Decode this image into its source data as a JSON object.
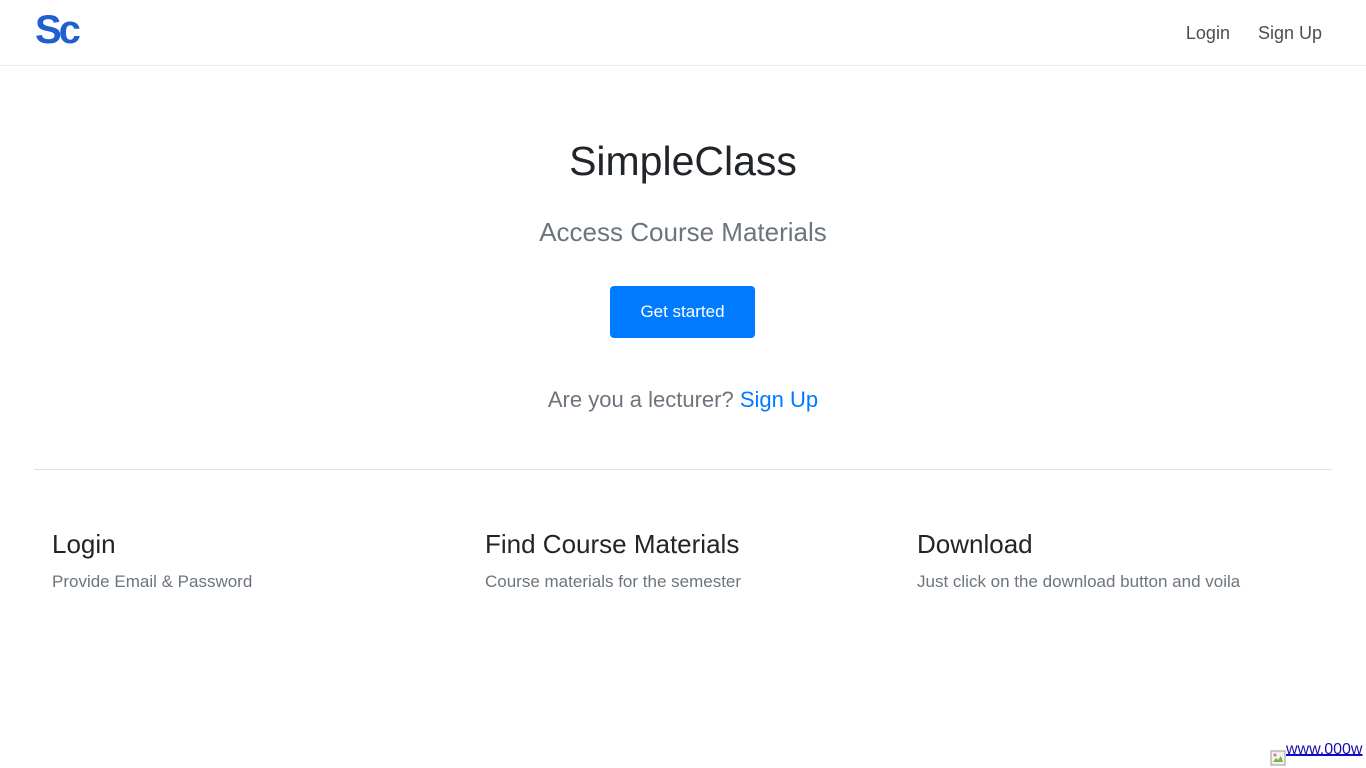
{
  "navbar": {
    "logo_text": "Sc",
    "links": [
      {
        "label": "Login"
      },
      {
        "label": "Sign Up"
      }
    ]
  },
  "hero": {
    "title": "SimpleClass",
    "subtitle": "Access Course Materials",
    "cta_label": "Get started",
    "lecturer_prompt": "Are you a lecturer?",
    "lecturer_link": "Sign Up"
  },
  "features": [
    {
      "title": "Login",
      "description": "Provide Email & Password"
    },
    {
      "title": "Find Course Materials",
      "description": "Course materials for the semester"
    },
    {
      "title": "Download",
      "description": "Just click on the download button and voila"
    }
  ],
  "badge": {
    "text": "www.000w"
  },
  "colors": {
    "accent": "#007bff",
    "logo": "#1f5fcf",
    "muted_text": "#6c757d"
  }
}
